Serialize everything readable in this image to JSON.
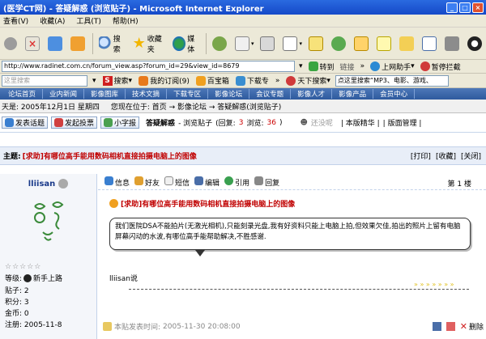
{
  "window": {
    "title": "(医学CT网) - 答疑解惑 (浏览贴子) - Microsoft Internet Explorer"
  },
  "menu": [
    "查看(V)",
    "收藏(A)",
    "工具(T)",
    "帮助(H)"
  ],
  "toolbar": {
    "search_label": "搜索",
    "favorites_label": "收藏夹",
    "media_label": "媒体"
  },
  "address": {
    "url": "http://www.radinet.com.cn/forum_view.asp?forum_id=29&view_id=8679",
    "go_label": "转到",
    "links_label": "链接",
    "online_helper": "上网助手",
    "block_popup": "暂停拦截"
  },
  "links": {
    "search_placeholder": "这里搜索",
    "search_btn": "搜索",
    "my_subscription": "我的订阅(9)",
    "baibaoxiang": "百宝箱",
    "download": "下载专",
    "tianxia_search": "天下搜索",
    "hint_text": "点这里搜索“MP3、电影、游戏、"
  },
  "site_nav": [
    "论坛首页",
    "业内新闻",
    "影像图库",
    "技术文摘",
    "下载专区",
    "影像论坛",
    "会议专题",
    "影像人才",
    "影像产品",
    "会员中心"
  ],
  "crumbs": {
    "date_text": "天是: 2005年12月1日 星期四",
    "location": "您现在位于: 首页 → 影像论坛 → 答疑解惑(浏览贴子)"
  },
  "actions": {
    "new_topic": "发表话题",
    "new_poll": "发起投票",
    "font_small": "小字报",
    "forum_name": "答疑解惑",
    "mode": "- 浏览贴子",
    "replies_label": "(回复:",
    "replies": "3",
    "views_label": "浏览:",
    "views": "36",
    "views_close": ")",
    "guest_label": "还没呢",
    "essence": "| 本版精华 |",
    "manage": "| 版面管理 |"
  },
  "topic": {
    "label": "主题:",
    "title": "[求助]有哪位高手能用数码相机直接拍摄电脑上的图像",
    "print": "[打印]",
    "fav": "[收藏]",
    "close": "[关闭]"
  },
  "user": {
    "name": "lliisan",
    "stars": "☆☆☆☆☆",
    "level_label": "等级:",
    "level": "新手上路",
    "posts": "贴子: 2",
    "points": "积分: 3",
    "gold": "金币: 0",
    "registered": "注册: 2005-11-8"
  },
  "post": {
    "tools": [
      "信息",
      "好友",
      "短信",
      "编辑",
      "引用",
      "回复"
    ],
    "floor": "第 1 楼",
    "title": "[求助]有哪位高手能用数码相机直接拍摄电脑上的图像",
    "body": "我们医院DSA不能拍片(无激光相机),只能刻录光盘,我有好资料只能上电脑上拍,但效果欠佳,拍出的照片上留有电脑屏幕闪动的水波,有哪位高手能帮助解决,不胜感谢.",
    "signature": "lliisan说",
    "watermark": "» » » » » » »",
    "time_label": "本贴发表时间:",
    "time": "2005-11-30 20:08:00",
    "delete": "删除"
  }
}
